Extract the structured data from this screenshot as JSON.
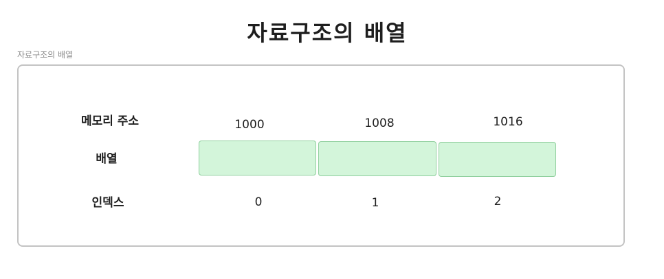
{
  "title": "자료구조의 배열",
  "frame_label": "자료구조의 배열",
  "row_labels": {
    "address": "메모리 주소",
    "array": "배열",
    "index": "인덱스"
  },
  "cells": [
    {
      "address": "1000",
      "index": "0"
    },
    {
      "address": "1008",
      "index": "1"
    },
    {
      "address": "1016",
      "index": "2"
    }
  ],
  "colors": {
    "cell_fill": "#d3f5da",
    "cell_stroke": "#8fcf9d",
    "frame_stroke": "#c3c3c3"
  }
}
